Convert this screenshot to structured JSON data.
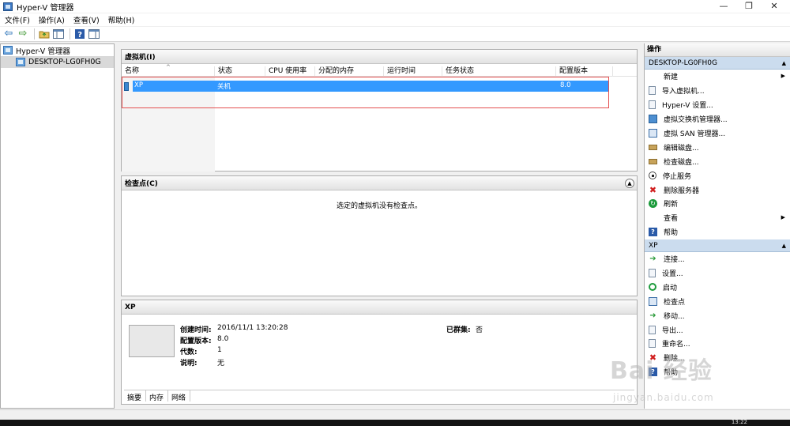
{
  "window": {
    "title": "Hyper-V 管理器",
    "controls": {
      "minimize": "—",
      "maximize": "❐",
      "close": "✕"
    }
  },
  "menubar": {
    "items": [
      "文件(F)",
      "操作(A)",
      "查看(V)",
      "帮助(H)"
    ]
  },
  "toolbar": {
    "buttons": [
      "back-arrow-icon",
      "forward-arrow-icon",
      "up-folder-icon",
      "show-hide-tree-icon",
      "help-icon",
      "show-hide-action-pane-icon"
    ]
  },
  "tree": {
    "root": "Hyper-V 管理器",
    "server": "DESKTOP-LG0FH0G"
  },
  "vm_panel": {
    "title": "虚拟机(I)",
    "columns": [
      "名称",
      "状态",
      "CPU 使用率",
      "分配的内存",
      "运行时间",
      "任务状态",
      "配置版本"
    ],
    "rows": [
      {
        "name": "XP",
        "state": "关机",
        "cpu": "",
        "memory": "",
        "uptime": "",
        "task": "",
        "version": "8.0"
      }
    ]
  },
  "checkpoint_panel": {
    "title": "检查点(C)",
    "empty_text": "选定的虚拟机没有检查点。"
  },
  "detail_panel": {
    "title": "XP",
    "fields": [
      {
        "label": "创建时间:",
        "value": "2016/11/1 13:20:28"
      },
      {
        "label": "配置版本:",
        "value": "8.0"
      },
      {
        "label": "代数:",
        "value": "1"
      },
      {
        "label": "说明:",
        "value": "无"
      }
    ],
    "clustered_label": "已群集:",
    "clustered_value": "否",
    "tabs": [
      "摘要",
      "内存",
      "网络"
    ]
  },
  "actions": {
    "title": "操作",
    "server_group": {
      "title": "DESKTOP-LG0FH0G",
      "items": [
        {
          "label": "新建",
          "icon": "none",
          "submenu": true
        },
        {
          "label": "导入虚拟机...",
          "icon": "import-icon"
        },
        {
          "label": "Hyper-V 设置...",
          "icon": "settings-doc-icon"
        },
        {
          "label": "虚拟交换机管理器...",
          "icon": "network-switch-icon"
        },
        {
          "label": "虚拟 SAN 管理器...",
          "icon": "san-icon"
        },
        {
          "label": "编辑磁盘...",
          "icon": "edit-disk-icon"
        },
        {
          "label": "检查磁盘...",
          "icon": "inspect-disk-icon"
        },
        {
          "label": "停止服务",
          "icon": "stop-icon"
        },
        {
          "label": "删除服务器",
          "icon": "delete-icon"
        },
        {
          "label": "刷新",
          "icon": "refresh-icon"
        },
        {
          "label": "查看",
          "icon": "none",
          "submenu": true
        },
        {
          "label": "帮助",
          "icon": "help-icon"
        }
      ]
    },
    "vm_group": {
      "title": "XP",
      "items": [
        {
          "label": "连接...",
          "icon": "connect-icon"
        },
        {
          "label": "设置...",
          "icon": "settings-icon"
        },
        {
          "label": "启动",
          "icon": "start-icon"
        },
        {
          "label": "检查点",
          "icon": "checkpoint-icon"
        },
        {
          "label": "移动...",
          "icon": "move-icon"
        },
        {
          "label": "导出...",
          "icon": "export-icon"
        },
        {
          "label": "重命名...",
          "icon": "rename-icon"
        },
        {
          "label": "删除...",
          "icon": "delete-icon"
        },
        {
          "label": "帮助",
          "icon": "help-icon"
        }
      ]
    }
  },
  "taskbar": {
    "clock": "13:22"
  },
  "watermark": {
    "brand": "Bai 经验",
    "url": "jingyan.baidu.com"
  }
}
